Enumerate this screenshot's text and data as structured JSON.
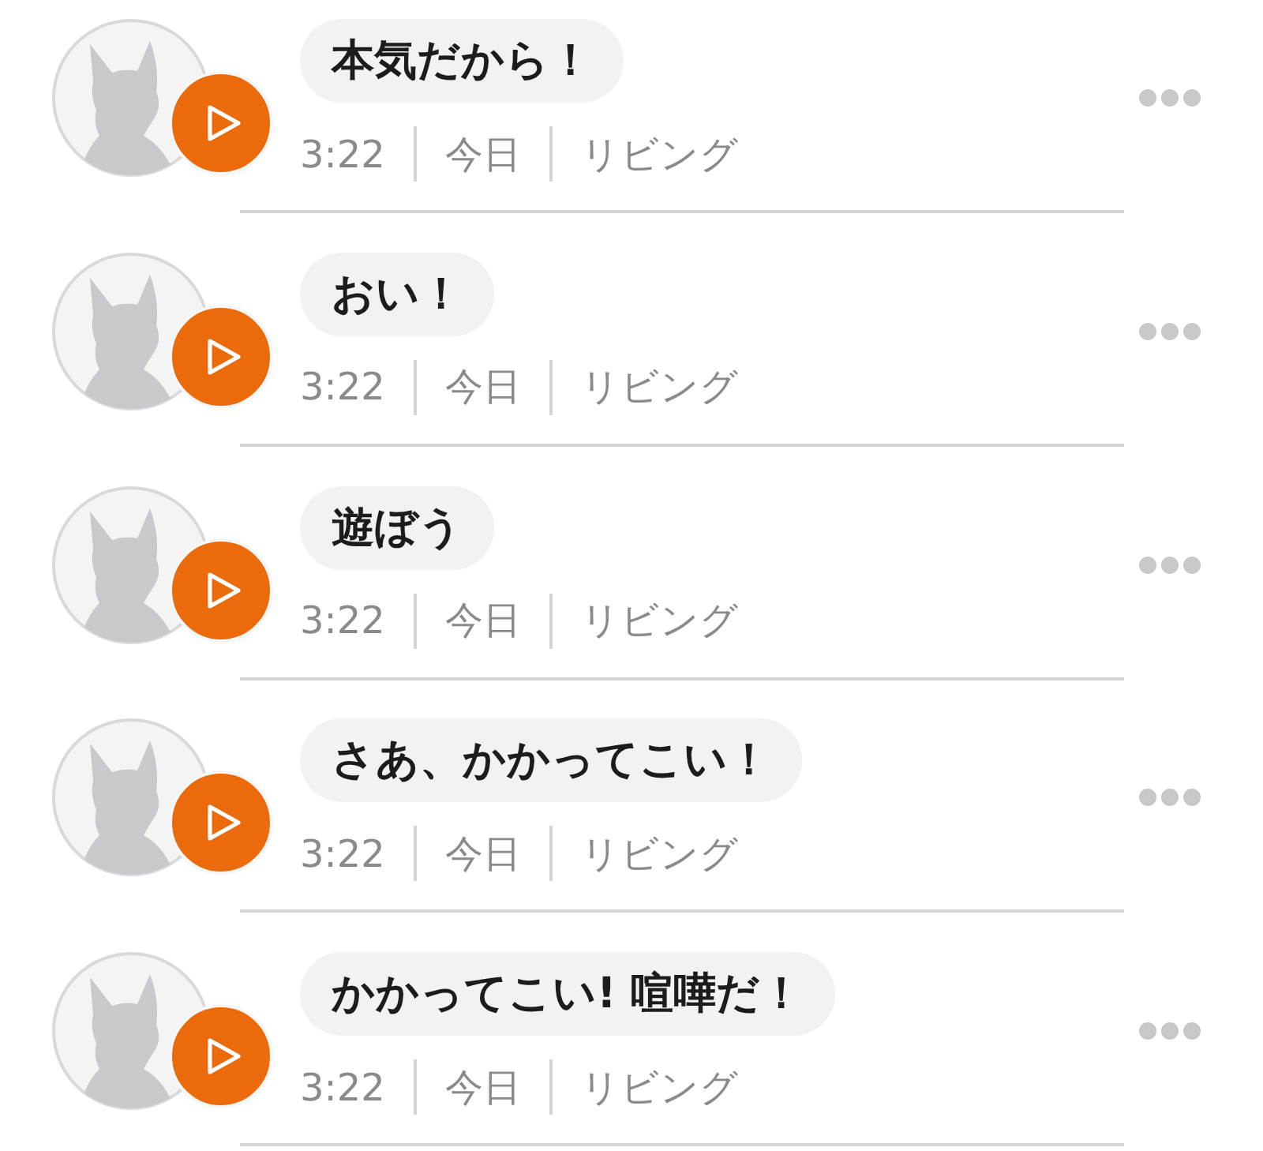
{
  "messages": [
    {
      "text": "本気だから！",
      "duration": "3:22",
      "day": "今日",
      "room": "リビング"
    },
    {
      "text": "おい！",
      "duration": "3:22",
      "day": "今日",
      "room": "リビング"
    },
    {
      "text": "遊ぼう",
      "duration": "3:22",
      "day": "今日",
      "room": "リビング"
    },
    {
      "text": "さあ、かかってこい！",
      "duration": "3:22",
      "day": "今日",
      "room": "リビング"
    },
    {
      "text": "かかってこい! 喧嘩だ！",
      "duration": "3:22",
      "day": "今日",
      "room": "リビング"
    }
  ]
}
